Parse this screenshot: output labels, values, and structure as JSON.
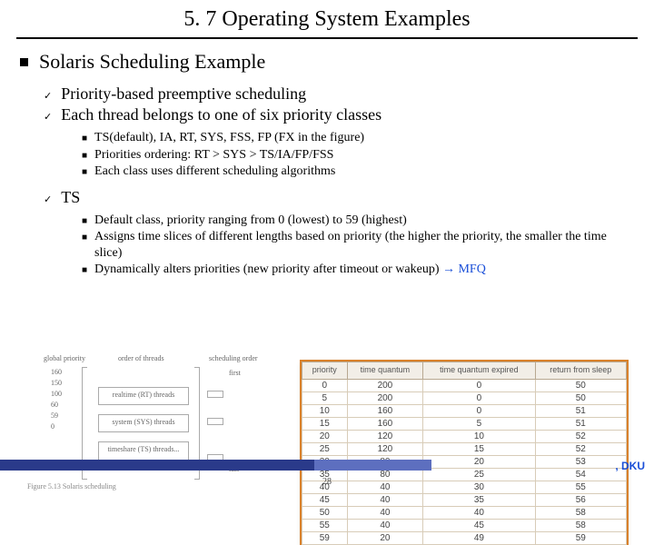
{
  "title": "5. 7 Operating System Examples",
  "section_heading": "Solaris Scheduling Example",
  "bullets": {
    "b1": "Priority-based preemptive scheduling",
    "b2": "Each thread belongs to one of six priority classes",
    "s1": "TS(default), IA, RT, SYS, FSS, FP (FX in the figure)",
    "s2": "Priorities ordering: RT >  SYS > TS/IA/FP/FSS",
    "s3": "Each class uses different scheduling algorithms",
    "b3": "TS",
    "t1": "Default class, priority ranging from 0 (lowest) to 59 (highest)",
    "t2": "Assigns time slices of different lengths based on priority (the higher the priority, the smaller the time slice)",
    "t3a": "Dynamically alters priorities (new priority after timeout or wakeup) ",
    "t3b": "→ MFQ"
  },
  "diagram": {
    "col1": "global\npriority",
    "col2": "scheduling\norder",
    "col3": "order of threads",
    "scale": [
      "160",
      "150",
      "100",
      "",
      "60",
      "59",
      "",
      "0"
    ],
    "boxes": {
      "rt": "realtime (RT) threads",
      "sys": "system (SYS) threads",
      "mix": "timeshare (TS) threads..."
    },
    "end_first": "first",
    "end_last": "last",
    "caption": "Figure 5.13   Solaris scheduling"
  },
  "table": {
    "headers": [
      "priority",
      "time\nquantum",
      "time\nquantum\nexpired",
      "return\nfrom\nsleep"
    ],
    "rows": [
      [
        "0",
        "200",
        "0",
        "50"
      ],
      [
        "5",
        "200",
        "0",
        "50"
      ],
      [
        "10",
        "160",
        "0",
        "51"
      ],
      [
        "15",
        "160",
        "5",
        "51"
      ],
      [
        "20",
        "120",
        "10",
        "52"
      ],
      [
        "25",
        "120",
        "15",
        "52"
      ],
      [
        "30",
        "80",
        "20",
        "53"
      ],
      [
        "35",
        "80",
        "25",
        "54"
      ],
      [
        "40",
        "40",
        "30",
        "55"
      ],
      [
        "45",
        "40",
        "35",
        "56"
      ],
      [
        "50",
        "40",
        "40",
        "58"
      ],
      [
        "55",
        "40",
        "45",
        "58"
      ],
      [
        "59",
        "20",
        "49",
        "59"
      ]
    ]
  },
  "footer": {
    "page": "28",
    "org": ", DKU"
  }
}
